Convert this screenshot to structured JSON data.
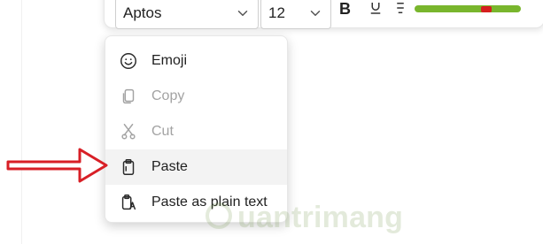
{
  "toolbar": {
    "font_name": "Aptos",
    "font_size": "12",
    "bold_label": "B"
  },
  "context_menu": {
    "items": [
      {
        "label": "Emoji",
        "icon": "emoji-icon",
        "enabled": true,
        "highlighted": false
      },
      {
        "label": "Copy",
        "icon": "copy-icon",
        "enabled": false,
        "highlighted": false
      },
      {
        "label": "Cut",
        "icon": "cut-icon",
        "enabled": false,
        "highlighted": false
      },
      {
        "label": "Paste",
        "icon": "paste-icon",
        "enabled": true,
        "highlighted": true
      },
      {
        "label": "Paste as plain text",
        "icon": "paste-plain-text-icon",
        "enabled": true,
        "highlighted": false
      }
    ]
  },
  "annotation": {
    "color": "#d81f26"
  },
  "watermark": {
    "text": "uantrimang"
  },
  "colors": {
    "highlight": "#f3f3f3",
    "disabled_text": "#a3a3a3",
    "text": "#1f1f1f",
    "green_swatch": "#7fbe33",
    "red_swatch": "#d61f1f"
  }
}
